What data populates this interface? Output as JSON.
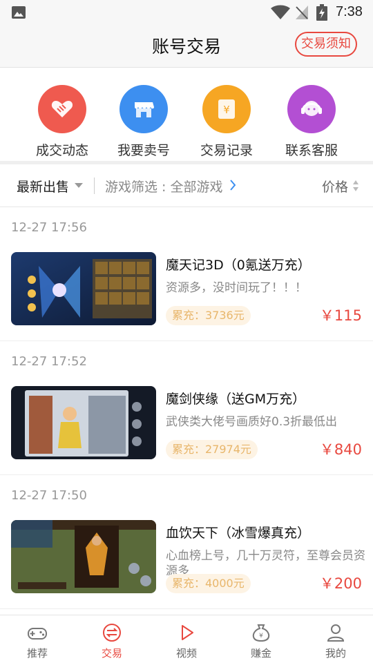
{
  "status_bar": {
    "time": "7:38"
  },
  "header": {
    "title": "账号交易",
    "notice_button": "交易须知"
  },
  "quick_actions": [
    {
      "label": "成交动态",
      "icon": "handshake-icon",
      "color": "#ef5a4f"
    },
    {
      "label": "我要卖号",
      "icon": "shop-icon",
      "color": "#3d8ff0"
    },
    {
      "label": "交易记录",
      "icon": "yen-record-icon",
      "color": "#f6a623"
    },
    {
      "label": "联系客服",
      "icon": "customer-service-icon",
      "color": "#b34fd3"
    }
  ],
  "filter": {
    "latest": "最新出售",
    "game_filter": "游戏筛选 : 全部游戏",
    "price": "价格"
  },
  "listings": [
    {
      "time": "12-27 17:56",
      "name": "魔天记3D（0氪送万充）",
      "desc": "资源多，没时间玩了！！！",
      "charge": "累充：3736元",
      "price": "￥115"
    },
    {
      "time": "12-27 17:52",
      "name": "魔剑侠缘（送GM万充）",
      "desc": "武侠类大佬号画质好0.3折最低出",
      "charge": "累充：27974元",
      "price": "￥840"
    },
    {
      "time": "12-27 17:50",
      "name": "血饮天下（冰雪爆真充）",
      "desc": "心血榜上号，几十万灵符，至尊会员资源多",
      "charge": "累充：4000元",
      "price": "￥200"
    }
  ],
  "tabs": [
    {
      "label": "推荐",
      "icon": "gamepad-icon"
    },
    {
      "label": "交易",
      "icon": "exchange-icon"
    },
    {
      "label": "视频",
      "icon": "play-icon"
    },
    {
      "label": "赚金",
      "icon": "money-bag-icon"
    },
    {
      "label": "我的",
      "icon": "profile-icon"
    }
  ],
  "colors": {
    "accent": "#e8483f",
    "charge_text": "#e8b66b",
    "charge_bg": "#fdf3e4"
  }
}
